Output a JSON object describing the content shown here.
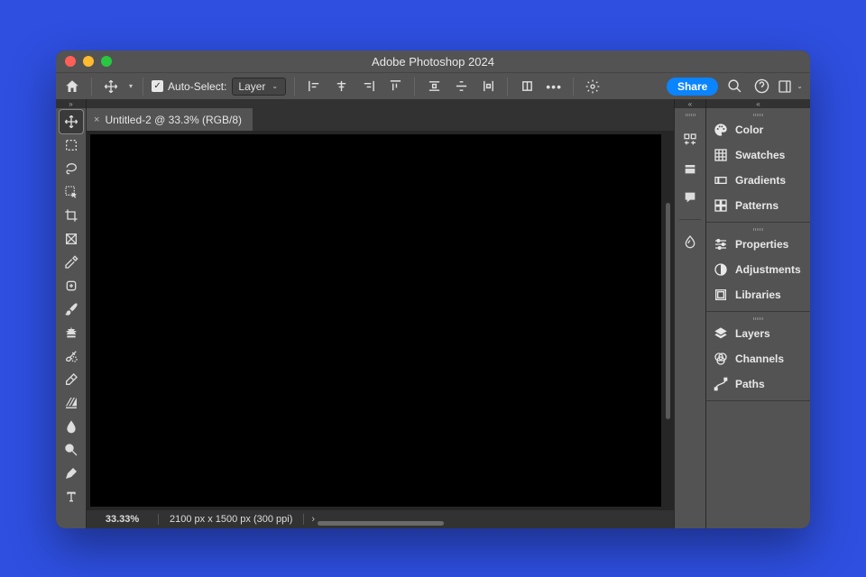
{
  "titlebar": {
    "title": "Adobe Photoshop 2024"
  },
  "optbar": {
    "autoselect_label": "Auto-Select:",
    "layer_dropdown": "Layer",
    "share_label": "Share"
  },
  "tab": {
    "label": "Untitled-2 @ 33.3% (RGB/8)"
  },
  "status": {
    "zoom": "33.33%",
    "dims": "2100 px x 1500 px (300 ppi)"
  },
  "toolbox": [
    {
      "name": "move-tool",
      "active": true
    },
    {
      "name": "marquee-tool"
    },
    {
      "name": "lasso-tool"
    },
    {
      "name": "object-select-tool"
    },
    {
      "name": "crop-tool"
    },
    {
      "name": "frame-tool"
    },
    {
      "name": "eyedropper-tool"
    },
    {
      "name": "healing-brush-tool"
    },
    {
      "name": "brush-tool"
    },
    {
      "name": "clone-stamp-tool"
    },
    {
      "name": "history-brush-tool"
    },
    {
      "name": "eraser-tool"
    },
    {
      "name": "gradient-tool"
    },
    {
      "name": "blur-tool"
    },
    {
      "name": "dodge-tool"
    },
    {
      "name": "pen-tool"
    },
    {
      "name": "type-tool"
    }
  ],
  "dock_minis": [
    {
      "name": "properties-icon"
    },
    {
      "name": "history-icon"
    },
    {
      "name": "comments-icon"
    },
    {
      "sep": true
    },
    {
      "name": "brushes-icon"
    }
  ],
  "panels": {
    "group1": [
      {
        "name": "color-panel",
        "label": "Color",
        "icon": "palette"
      },
      {
        "name": "swatches-panel",
        "label": "Swatches",
        "icon": "grid"
      },
      {
        "name": "gradients-panel",
        "label": "Gradients",
        "icon": "gradient"
      },
      {
        "name": "patterns-panel",
        "label": "Patterns",
        "icon": "pattern"
      }
    ],
    "group2": [
      {
        "name": "properties-panel",
        "label": "Properties",
        "icon": "sliders"
      },
      {
        "name": "adjustments-panel",
        "label": "Adjustments",
        "icon": "halfcircle"
      },
      {
        "name": "libraries-panel",
        "label": "Libraries",
        "icon": "library"
      }
    ],
    "group3": [
      {
        "name": "layers-panel",
        "label": "Layers",
        "icon": "layers"
      },
      {
        "name": "channels-panel",
        "label": "Channels",
        "icon": "channels"
      },
      {
        "name": "paths-panel",
        "label": "Paths",
        "icon": "paths"
      }
    ]
  }
}
